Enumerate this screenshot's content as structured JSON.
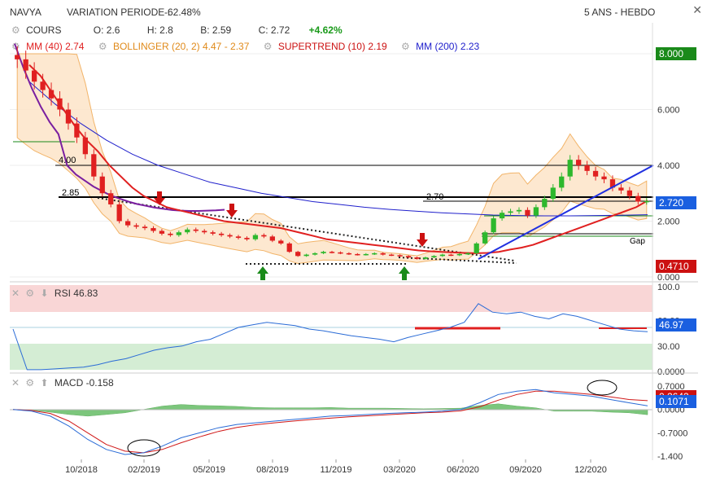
{
  "header": {
    "symbol": "NAVYA",
    "variation_label": "VARIATION PERIODE :",
    "variation_value": "-62.48%",
    "period": "5 ANS - HEBDO",
    "close": "✕"
  },
  "legend": {
    "cours_label": "COURS",
    "open": "O: 2.6",
    "high": "H: 2.8",
    "low": "B: 2.59",
    "close": "C: 2.72",
    "change": "+4.62%",
    "mm40_label": "MM (40)",
    "mm40_value": "2.74",
    "bollinger_label": "BOLLINGER (20, 2)",
    "bollinger_value": "4.47 - 2.37",
    "supertrend_label": "SUPERTREND (10)",
    "supertrend_value": "2.19",
    "mm200_label": "MM (200)",
    "mm200_value": "2.23"
  },
  "price_panel": {
    "annotations": [
      "4.00",
      "2.85",
      "2.70",
      "Gap"
    ],
    "badges": {
      "top": "8.000",
      "last": "2.720",
      "low": "0.4710"
    }
  },
  "rsi_panel": {
    "label": "RSI",
    "value": "46.83",
    "badge": "46.97"
  },
  "macd_panel": {
    "label": "MACD",
    "value": "-0.158",
    "badge_red": "0.2642",
    "badge_blue": "0.1071"
  },
  "colors": {
    "up": "#2db82d",
    "down": "#e02020",
    "mm40": "#e02020",
    "mm200": "#2020cc",
    "bollinger_fill": "#fde0c0",
    "bollinger_line": "#f0a040",
    "rsi_line": "#2a6bd6",
    "badge_green": "#1a8a1a",
    "badge_blue": "#1a5fe0",
    "badge_red": "#cc1111",
    "supertrend": "#7a1fa0"
  },
  "chart_data": [
    {
      "type": "line",
      "title": "",
      "x_ticks": [
        "10/2018",
        "02/2019",
        "05/2019",
        "08/2019",
        "11/2019",
        "03/2020",
        "06/2020",
        "09/2020",
        "12/2020"
      ],
      "y_ticks": [
        "8.000",
        "6.000",
        "4.000",
        "2.000",
        "0.000"
      ],
      "ylim": [
        0,
        8.2
      ],
      "series": [
        {
          "name": "COURS",
          "values": [
            7.8,
            7.4,
            7.0,
            6.7,
            6.4,
            6.0,
            5.5,
            5.0,
            4.4,
            3.6,
            3.0,
            2.6,
            2.0,
            1.85,
            1.8,
            1.75,
            1.65,
            1.55,
            1.5,
            1.6,
            1.7,
            1.65,
            1.6,
            1.55,
            1.5,
            1.45,
            1.4,
            1.35,
            1.5,
            1.45,
            1.3,
            1.2,
            0.9,
            0.75,
            0.8,
            0.85,
            0.9,
            0.88,
            0.85,
            0.82,
            0.8,
            0.82,
            0.85,
            0.8,
            0.78,
            0.75,
            0.7,
            0.65,
            0.7,
            0.75,
            0.8,
            0.78,
            0.82,
            0.85,
            1.2,
            1.6,
            2.1,
            2.3,
            2.35,
            2.4,
            2.2,
            2.5,
            2.8,
            3.2,
            3.6,
            4.2,
            4.0,
            3.8,
            3.6,
            3.5,
            3.2,
            3.1,
            2.9,
            2.7,
            2.72
          ]
        },
        {
          "name": "MM (40)",
          "values": [
            7.6,
            7.2,
            6.6,
            6.0,
            5.4,
            4.9,
            4.5,
            4.0,
            3.6,
            3.2,
            2.9,
            2.7,
            2.5,
            2.4,
            2.3,
            2.2,
            2.1,
            2.0,
            1.95,
            1.9,
            1.85,
            1.8,
            1.75,
            1.65,
            1.55,
            1.45,
            1.35,
            1.3,
            1.25,
            1.2,
            1.15,
            1.1,
            1.05,
            1.0,
            0.95,
            0.92,
            0.9,
            0.88,
            0.86,
            0.85,
            0.86,
            0.9,
            0.98,
            1.05,
            1.15,
            1.3,
            1.45,
            1.6,
            1.75,
            1.9,
            2.05,
            2.2,
            2.35,
            2.5,
            2.74
          ]
        },
        {
          "name": "MM (200)",
          "values": [
            7.0,
            6.2,
            5.5,
            4.9,
            4.4,
            4.0,
            3.7,
            3.4,
            3.2,
            3.0,
            2.85,
            2.7,
            2.6,
            2.5,
            2.42,
            2.36,
            2.3,
            2.26,
            2.22,
            2.2,
            2.19,
            2.19,
            2.2,
            2.21,
            2.23
          ]
        }
      ]
    },
    {
      "type": "line",
      "title": "",
      "y_ticks": [
        "100.0",
        "60.00",
        "30.00",
        "0.0000"
      ],
      "ylim": [
        0,
        100
      ],
      "series": [
        {
          "name": "RSI",
          "values": [
            50,
            2,
            2,
            3,
            4,
            5,
            8,
            12,
            15,
            20,
            25,
            28,
            30,
            35,
            38,
            45,
            52,
            55,
            58,
            56,
            54,
            50,
            48,
            45,
            42,
            40,
            38,
            35,
            40,
            44,
            48,
            52,
            58,
            80,
            70,
            68,
            70,
            65,
            62,
            68,
            65,
            60,
            55,
            50,
            48,
            46.83
          ]
        }
      ]
    },
    {
      "type": "line",
      "title": "",
      "y_ticks": [
        "0.7000",
        "0.0000",
        "-0.7000",
        "-1.400"
      ],
      "ylim": [
        -1.4,
        0.8
      ],
      "series": [
        {
          "name": "MACD",
          "values": [
            0,
            -0.05,
            -0.2,
            -0.5,
            -0.9,
            -1.2,
            -1.35,
            -1.3,
            -1.1,
            -0.85,
            -0.7,
            -0.55,
            -0.45,
            -0.4,
            -0.35,
            -0.3,
            -0.25,
            -0.2,
            -0.18,
            -0.15,
            -0.12,
            -0.1,
            -0.08,
            -0.05,
            0.0,
            0.2,
            0.45,
            0.55,
            0.6,
            0.5,
            0.45,
            0.4,
            0.3,
            0.2,
            0.1071
          ]
        },
        {
          "name": "Signal",
          "values": [
            0,
            -0.03,
            -0.12,
            -0.35,
            -0.7,
            -1.05,
            -1.25,
            -1.3,
            -1.2,
            -1.0,
            -0.82,
            -0.66,
            -0.54,
            -0.46,
            -0.4,
            -0.35,
            -0.3,
            -0.26,
            -0.22,
            -0.19,
            -0.16,
            -0.13,
            -0.1,
            -0.08,
            -0.04,
            0.08,
            0.28,
            0.45,
            0.55,
            0.55,
            0.5,
            0.45,
            0.38,
            0.3,
            0.2642
          ]
        }
      ]
    }
  ]
}
